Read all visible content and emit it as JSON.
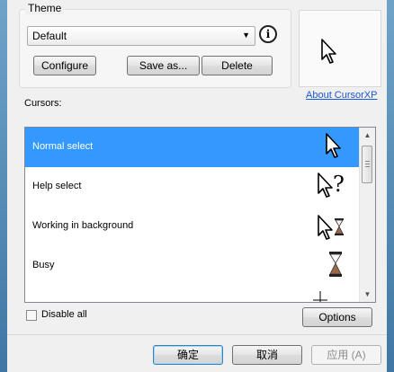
{
  "theme": {
    "legend": "Theme",
    "selected": "Default",
    "dropdown_arrow": "▼",
    "info_icon": "i",
    "buttons": {
      "configure": "Configure",
      "save_as": "Save as...",
      "delete": "Delete"
    }
  },
  "preview": {
    "icon": "arrow-cursor-icon"
  },
  "about_link": "About CursorXP",
  "cursors": {
    "label": "Cursors:",
    "items": [
      {
        "label": "Normal select",
        "icon": "arrow-cursor-icon",
        "selected": true
      },
      {
        "label": "Help select",
        "icon": "help-cursor-icon",
        "selected": false
      },
      {
        "label": "Working in background",
        "icon": "working-cursor-icon",
        "selected": false
      },
      {
        "label": "Busy",
        "icon": "hourglass-icon",
        "selected": false
      }
    ],
    "partial_icon": "precision-cursor-icon"
  },
  "disable_all": {
    "label": "Disable all",
    "checked": false
  },
  "options_label": "Options",
  "footer": {
    "ok": "确定",
    "cancel": "取消",
    "apply": "应用 (A)",
    "apply_enabled": false
  },
  "colors": {
    "selection": "#3399ff",
    "link": "#1a57d6"
  }
}
